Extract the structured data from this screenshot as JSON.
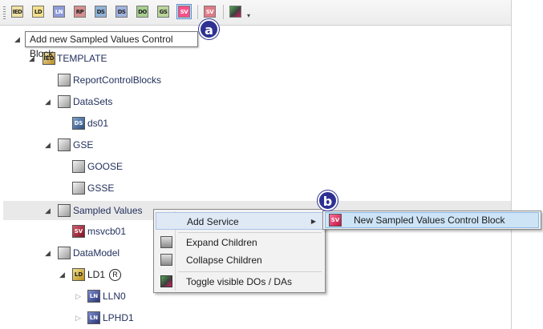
{
  "toolbar": {
    "buttons": [
      {
        "text": "IED",
        "bg": "#efe1a2"
      },
      {
        "text": "LD",
        "bg": "#f3e08b"
      },
      {
        "text": "LN",
        "bg": "#8f9bd8"
      },
      {
        "text": "RP",
        "bg": "#d88f8f"
      },
      {
        "text": "DS",
        "bg": "#8fb2d8"
      },
      {
        "text": "DS",
        "bg": "#9fb4df"
      },
      {
        "text": "DO",
        "bg": "#a7cf8f"
      },
      {
        "text": "GS",
        "bg": "#b9d49a"
      },
      {
        "text": "SV",
        "bg": "#ff4f8a"
      },
      {
        "text": "SV",
        "bg": "#e07a86"
      },
      {
        "text": "",
        "bg": "#3f3f3f"
      }
    ],
    "tooltip": "Add new Sampled Values Control Block"
  },
  "callouts": {
    "a": "a",
    "b": "b"
  },
  "tree": {
    "template": "TEMPLATE",
    "report_control_blocks": "ReportControlBlocks",
    "datasets": "DataSets",
    "ds01": "ds01",
    "gse": "GSE",
    "goose": "GOOSE",
    "gsse": "GSSE",
    "sampled_values": "Sampled Values",
    "msvcb01": "msvcb01",
    "data_model": "DataModel",
    "ld1": "LD1",
    "ld1_mark": "R",
    "lln0": "LLN0",
    "lphd1": "LPHD1"
  },
  "context_menu": {
    "add_service": "Add Service",
    "expand_children": "Expand Children",
    "collapse_children": "Collapse Children",
    "toggle_visible": "Toggle visible DOs / DAs"
  },
  "submenu": {
    "new_sv_cb": "New Sampled Values Control Block"
  },
  "icons": {
    "ied": "IED",
    "ds": "DS",
    "sv": "SV",
    "ld": "LD",
    "ln": "LN"
  }
}
